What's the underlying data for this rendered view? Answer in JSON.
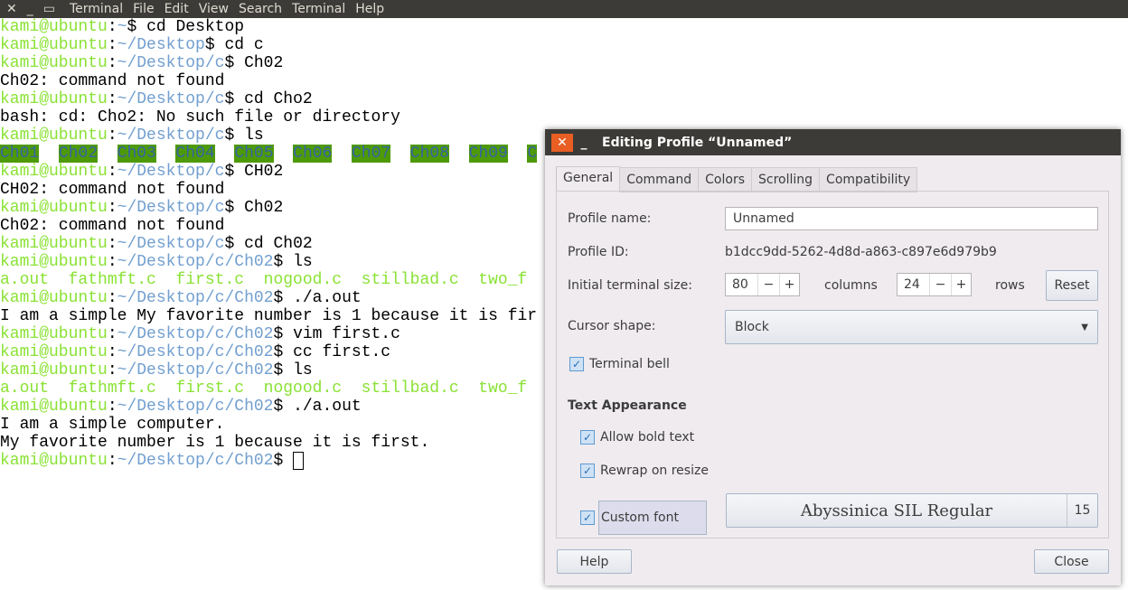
{
  "menubar": {
    "icons": [
      "close-icon",
      "minimize-icon",
      "maximize-icon"
    ],
    "items": [
      "Terminal",
      "File",
      "Edit",
      "View",
      "Search",
      "Terminal",
      "Help"
    ]
  },
  "terminal": {
    "user": "kami@ubuntu",
    "lines": [
      {
        "t": "prompt",
        "path": "~",
        "cmd": " cd Desktop"
      },
      {
        "t": "prompt",
        "path": "~/Desktop",
        "cmd": " cd c"
      },
      {
        "t": "prompt",
        "path": "~/Desktop/c",
        "cmd": " Ch02"
      },
      {
        "t": "out",
        "text": "Ch02: command not found"
      },
      {
        "t": "prompt",
        "path": "~/Desktop/c",
        "cmd": " cd Cho2"
      },
      {
        "t": "out",
        "text": "bash: cd: Cho2: No such file or directory"
      },
      {
        "t": "prompt",
        "path": "~/Desktop/c",
        "cmd": " ls"
      },
      {
        "t": "dirs",
        "items": [
          "Ch01",
          "Ch02",
          "Ch03",
          "Ch04",
          "Ch05",
          "Ch06",
          "Ch07",
          "Ch08",
          "Ch09",
          "C"
        ]
      },
      {
        "t": "prompt",
        "path": "~/Desktop/c",
        "cmd": " CH02"
      },
      {
        "t": "out",
        "text": "CH02: command not found"
      },
      {
        "t": "prompt",
        "path": "~/Desktop/c",
        "cmd": " Ch02"
      },
      {
        "t": "out",
        "text": "Ch02: command not found"
      },
      {
        "t": "prompt",
        "path": "~/Desktop/c",
        "cmd": " cd Ch02"
      },
      {
        "t": "prompt",
        "path": "~/Desktop/c/Ch02",
        "cmd": " ls"
      },
      {
        "t": "files",
        "text": "a.out  fathmft.c  first.c  nogood.c  stillbad.c  two_f"
      },
      {
        "t": "prompt",
        "path": "~/Desktop/c/Ch02",
        "cmd": " ./a.out"
      },
      {
        "t": "out",
        "text": "I am a simple My favorite number is 1 because it is fir"
      },
      {
        "t": "prompt",
        "path": "~/Desktop/c/Ch02",
        "cmd": " vim first.c"
      },
      {
        "t": "prompt",
        "path": "~/Desktop/c/Ch02",
        "cmd": " cc first.c"
      },
      {
        "t": "prompt",
        "path": "~/Desktop/c/Ch02",
        "cmd": " ls"
      },
      {
        "t": "files",
        "text": "a.out  fathmft.c  first.c  nogood.c  stillbad.c  two_f"
      },
      {
        "t": "prompt",
        "path": "~/Desktop/c/Ch02",
        "cmd": " ./a.out"
      },
      {
        "t": "out",
        "text": "I am a simple computer."
      },
      {
        "t": "out",
        "text": "My favorite number is 1 because it is first."
      },
      {
        "t": "prompt",
        "path": "~/Desktop/c/Ch02",
        "cmd": " ",
        "cursor": true
      }
    ]
  },
  "dialog": {
    "title": "Editing Profile “Unnamed”",
    "tabs": [
      "General",
      "Command",
      "Colors",
      "Scrolling",
      "Compatibility"
    ],
    "active_tab": "General",
    "profile_name_label": "Profile name:",
    "profile_name": "Unnamed",
    "profile_id_label": "Profile ID:",
    "profile_id": "b1dcc9dd-5262-4d8d-a863-c897e6d979b9",
    "size_label": "Initial terminal size:",
    "columns": "80",
    "columns_label": "columns",
    "rows": "24",
    "rows_label": "rows",
    "reset": "Reset",
    "cursor_label": "Cursor shape:",
    "cursor_value": "Block",
    "bell_label": "Terminal bell",
    "bell": true,
    "text_appearance": "Text Appearance",
    "bold_label": "Allow bold text",
    "bold": true,
    "rewrap_label": "Rewrap on resize",
    "rewrap": true,
    "font_label": "Custom font",
    "custom_font": true,
    "font_name": "Abyssinica SIL Regular",
    "font_size": "15",
    "help": "Help",
    "close": "Close",
    "minus": "−",
    "plus": "+"
  },
  "colors": {
    "user": "#8ae234",
    "path": "#729fcf",
    "dir_bg": "#4e9a06",
    "dir_fg": "#3465a4",
    "close_button": "#e85e23"
  }
}
